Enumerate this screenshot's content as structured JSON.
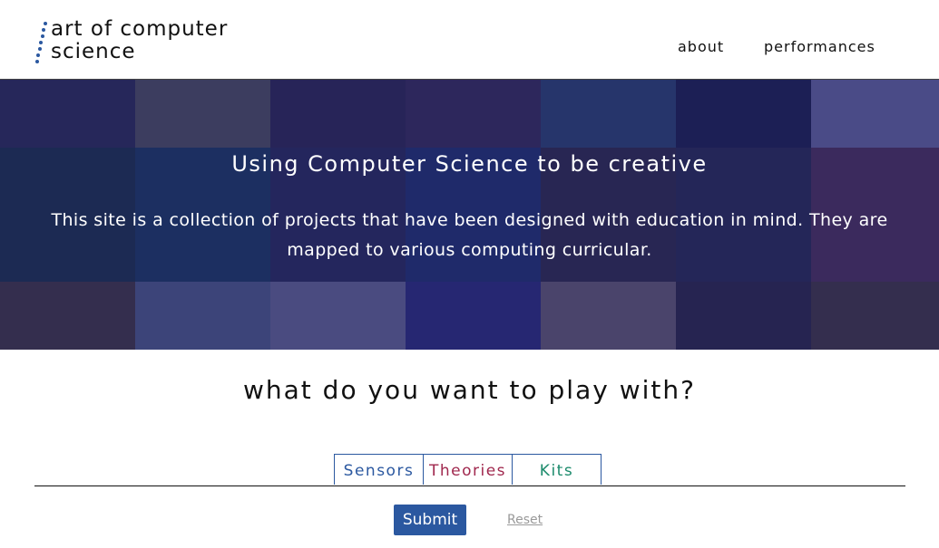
{
  "header": {
    "logo_line1": "art of computer",
    "logo_line2": "science",
    "nav": [
      "about",
      "performances"
    ]
  },
  "hero": {
    "title": "Using Computer Science to be creative",
    "description": "This site is a collection of projects that have been designed with education in mind. They are mapped to various computing curricular."
  },
  "question": "what do you want to play with?",
  "tabs": [
    {
      "label": "Sensors",
      "color": "#2b58a0"
    },
    {
      "label": "Theories",
      "color": "#a0284e"
    },
    {
      "label": "Kits",
      "color": "#1b8a6b"
    }
  ],
  "form": {
    "submit_label": "Submit",
    "reset_label": "Reset"
  },
  "colors": {
    "accent": "#2b58a0",
    "hero_overlay": "#16185f"
  }
}
